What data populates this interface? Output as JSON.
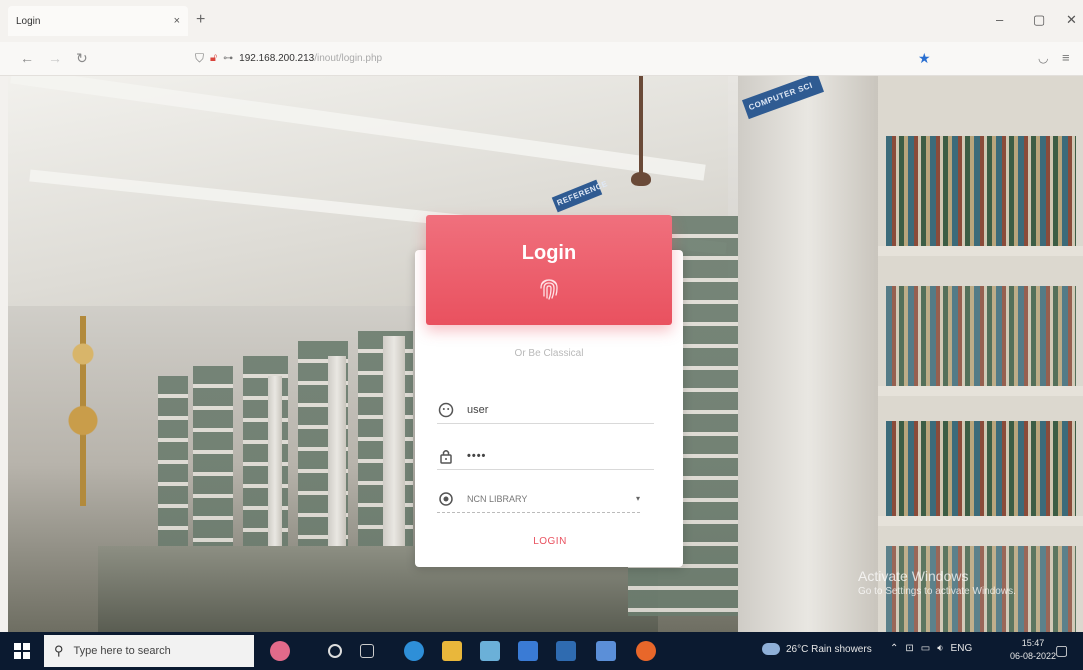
{
  "browser": {
    "tab_title": "Login",
    "tab_close": "×",
    "new_tab": "+",
    "url_host": "192.168.200.213",
    "url_path": "/inout/login.php",
    "window": {
      "minimize": "–",
      "restore": "▢",
      "close": "✕"
    }
  },
  "login": {
    "title": "Login",
    "alt_text": "Or Be Classical",
    "username_value": "user",
    "password_value": "••••",
    "library_selected": "NCN LIBRARY",
    "submit_label": "LOGIN",
    "accent_color": "#e9515f"
  },
  "watermark": {
    "line1": "Activate Windows",
    "line2": "Go to Settings to activate Windows."
  },
  "signs": {
    "computer_section": "COMPUTER SCI",
    "reference": "REFERENCE"
  },
  "taskbar": {
    "search_placeholder": "Type here to search",
    "weather": "26°C  Rain showers",
    "language": "ENG",
    "time": "15:47",
    "date": "06-08-2022"
  }
}
